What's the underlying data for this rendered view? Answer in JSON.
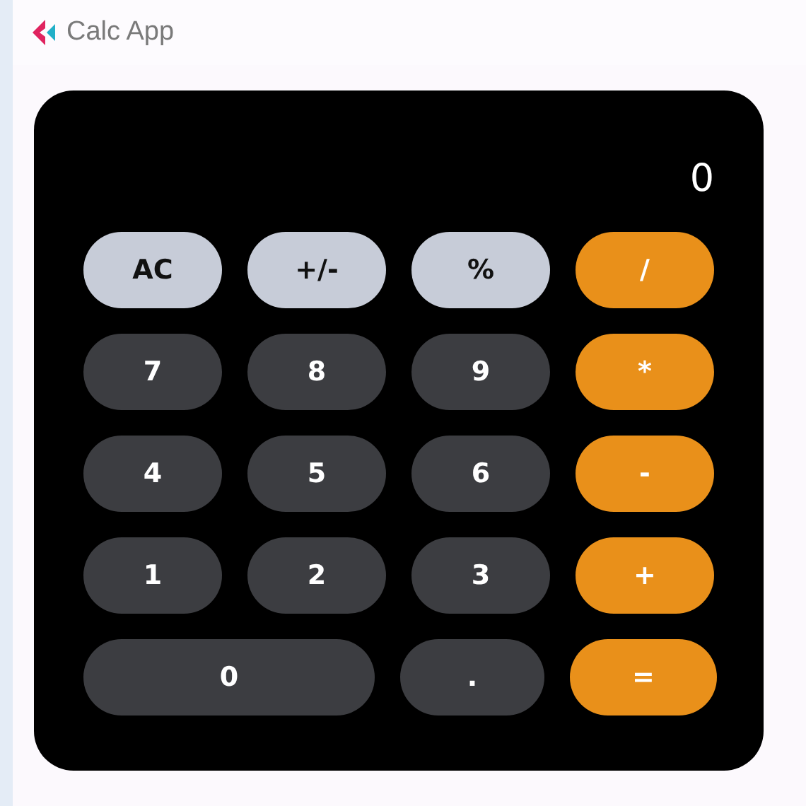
{
  "window": {
    "title": "Calc App"
  },
  "display": "0",
  "rows": [
    [
      {
        "label": "AC",
        "kind": "function"
      },
      {
        "label": "+/-",
        "kind": "function"
      },
      {
        "label": "%",
        "kind": "function"
      },
      {
        "label": "/",
        "kind": "operator"
      }
    ],
    [
      {
        "label": "7",
        "kind": "digit"
      },
      {
        "label": "8",
        "kind": "digit"
      },
      {
        "label": "9",
        "kind": "digit"
      },
      {
        "label": "*",
        "kind": "operator"
      }
    ],
    [
      {
        "label": "4",
        "kind": "digit"
      },
      {
        "label": "5",
        "kind": "digit"
      },
      {
        "label": "6",
        "kind": "digit"
      },
      {
        "label": "-",
        "kind": "operator"
      }
    ],
    [
      {
        "label": "1",
        "kind": "digit"
      },
      {
        "label": "2",
        "kind": "digit"
      },
      {
        "label": "3",
        "kind": "digit"
      },
      {
        "label": "+",
        "kind": "operator"
      }
    ],
    [
      {
        "label": "0",
        "kind": "wide-digit"
      },
      {
        "label": ".",
        "kind": "digit"
      },
      {
        "label": "=",
        "kind": "operator"
      }
    ]
  ]
}
